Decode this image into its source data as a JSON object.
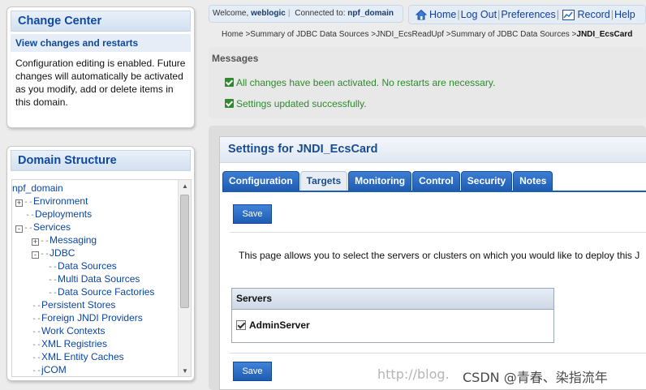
{
  "change_center": {
    "title": "Change Center",
    "link": "View changes and restarts",
    "text": "Configuration editing is enabled. Future changes will automatically be activated as you modify, add or delete items in this domain."
  },
  "domain_structure": {
    "title": "Domain Structure",
    "tree": [
      {
        "label": "npf_domain",
        "prefix": "",
        "toggle": ""
      },
      {
        "label": "Environment",
        "prefix": "",
        "toggle": "+"
      },
      {
        "label": "Deployments",
        "prefix": "---",
        "toggle": ""
      },
      {
        "label": "Services",
        "prefix": "",
        "toggle": "-"
      },
      {
        "label": "Messaging",
        "prefix": "   ---",
        "toggle": "+"
      },
      {
        "label": "JDBC",
        "prefix": "   ---",
        "toggle": "-"
      },
      {
        "label": "Data Sources",
        "prefix": "        ---",
        "toggle": ""
      },
      {
        "label": "Multi Data Sources",
        "prefix": "        ---",
        "toggle": ""
      },
      {
        "label": "Data Source Factories",
        "prefix": "        ---",
        "toggle": ""
      },
      {
        "label": "Persistent Stores",
        "prefix": "   ---",
        "toggle": ""
      },
      {
        "label": "Foreign JNDI Providers",
        "prefix": "   ---",
        "toggle": ""
      },
      {
        "label": "Work Contexts",
        "prefix": "   ---",
        "toggle": ""
      },
      {
        "label": "XML Registries",
        "prefix": "   ---",
        "toggle": ""
      },
      {
        "label": "XML Entity Caches",
        "prefix": "   ---",
        "toggle": ""
      },
      {
        "label": "jCOM",
        "prefix": "   ---",
        "toggle": ""
      }
    ]
  },
  "header": {
    "welcome_label": "Welcome,",
    "user": "weblogic",
    "connected_label": "Connected to:",
    "domain": "npf_domain",
    "nav": {
      "home": "Home",
      "logout": "Log Out",
      "preferences": "Preferences",
      "record": "Record",
      "help": "Help"
    }
  },
  "breadcrumb": {
    "path": "Home >Summary of JDBC Data Sources >JNDI_EcsReadUpf >Summary of JDBC Data Sources >",
    "current": "JNDI_EcsCard"
  },
  "messages": {
    "title": "Messages",
    "items": [
      "All changes have been activated. No restarts are necessary.",
      "Settings updated successfully."
    ]
  },
  "settings": {
    "title": "Settings for JNDI_EcsCard",
    "tabs": [
      "Configuration",
      "Targets",
      "Monitoring",
      "Control",
      "Security",
      "Notes"
    ],
    "active_tab": "Targets",
    "save_label": "Save",
    "description": "This page allows you to select the servers or clusters on which you would like to deploy this J",
    "servers_header": "Servers",
    "server": {
      "name": "AdminServer",
      "checked": true
    }
  },
  "overlay": {
    "url_watermark": "http://blog.",
    "csdn": "CSDN @青春、染指流年"
  },
  "colors": {
    "link": "#0b46a4",
    "tab": "#1f5db3",
    "success": "#2e8a2e"
  }
}
